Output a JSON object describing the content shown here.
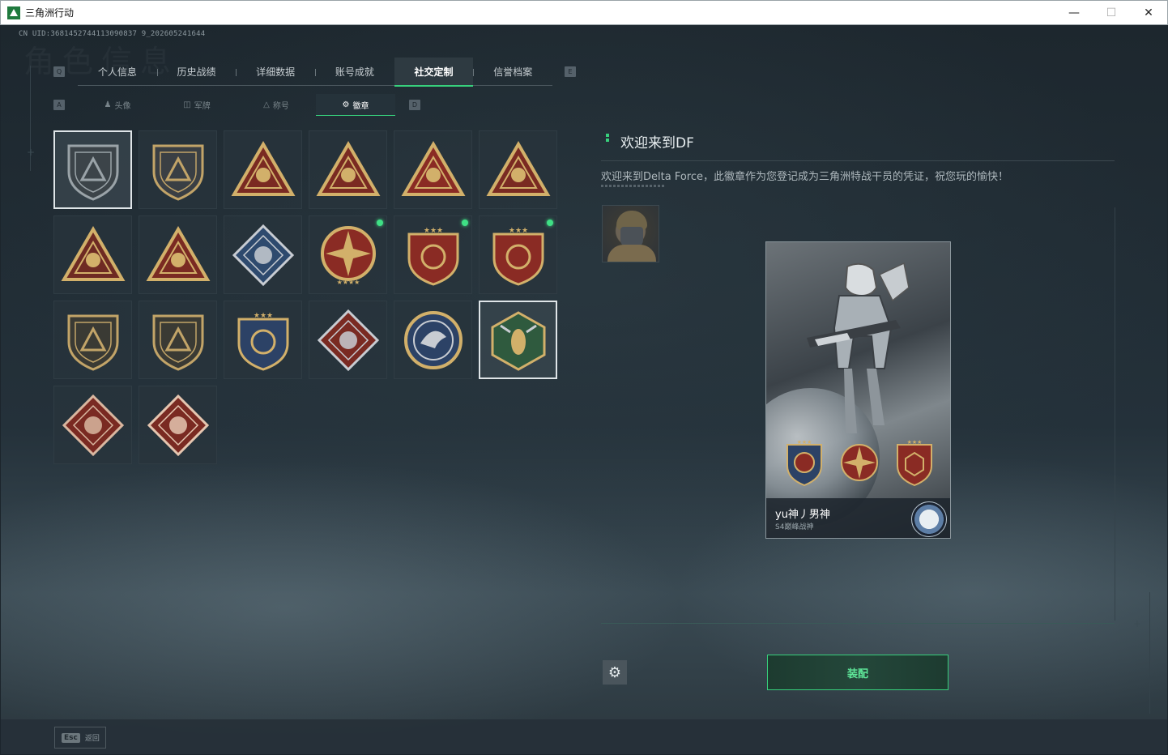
{
  "window": {
    "title": "三角洲行动",
    "minimize": "—",
    "maximize": "☐",
    "close": "✕"
  },
  "header": {
    "uid": "CN UID:3681452744113090837 9_202605241644",
    "ghost_title": "角色信息"
  },
  "top_tabs": {
    "left_key": "Q",
    "right_key": "E",
    "items": [
      {
        "label": "个人信息"
      },
      {
        "label": "历史战绩"
      },
      {
        "label": "详细数据"
      },
      {
        "label": "账号成就"
      },
      {
        "label": "社交定制",
        "active": true
      },
      {
        "label": "信誉档案"
      }
    ]
  },
  "sub_tabs": {
    "left_key": "A",
    "right_key": "D",
    "items": [
      {
        "label": "头像",
        "icon": "person-icon"
      },
      {
        "label": "军牌",
        "icon": "dogtag-icon"
      },
      {
        "label": "称号",
        "icon": "title-icon"
      },
      {
        "label": "徽章",
        "icon": "badge-icon",
        "active": true
      }
    ]
  },
  "badges": [
    {
      "name": "delta-triangle-badge",
      "shape": "shield",
      "color": "#3c4449",
      "accent": "#9aa3a8",
      "selected": true
    },
    {
      "name": "helicopter-badge",
      "shape": "shield",
      "color": "#3a3f44",
      "accent": "#c2a468"
    },
    {
      "name": "s5-season-badge",
      "shape": "triangle",
      "color": "#7a2a22",
      "accent": "#d2b06a"
    },
    {
      "name": "s7-season-badge",
      "shape": "triangle",
      "color": "#7a2a22",
      "accent": "#d2b06a"
    },
    {
      "name": "number-one-badge",
      "shape": "triangle",
      "color": "#8a2b24",
      "accent": "#d2b06a"
    },
    {
      "name": "hexagram-hands-badge",
      "shape": "triangle",
      "color": "#7a2a22",
      "accent": "#d2b06a"
    },
    {
      "name": "soldiers-badge",
      "shape": "triangle",
      "color": "#6e2a23",
      "accent": "#d2b06a"
    },
    {
      "name": "fish-badge",
      "shape": "triangle",
      "color": "#7a2a22",
      "accent": "#d2b06a"
    },
    {
      "name": "rose-badge",
      "shape": "diamond",
      "color": "#2e4a6e",
      "accent": "#c8ccd2"
    },
    {
      "name": "compass-star-badge",
      "shape": "round-shield",
      "color": "#8a2b24",
      "accent": "#d2b06a",
      "dot": true
    },
    {
      "name": "wing-emblem-badge",
      "shape": "crest",
      "color": "#8a2b24",
      "accent": "#d2b06a",
      "dot": true
    },
    {
      "name": "hex-crest-badge",
      "shape": "crest",
      "color": "#8a2b24",
      "accent": "#d2b06a",
      "dot": true
    },
    {
      "name": "rifle-shield-badge",
      "shape": "shield",
      "color": "#3a3a34",
      "accent": "#c2a468"
    },
    {
      "name": "rifle-shield-badge-2",
      "shape": "shield",
      "color": "#3a3a34",
      "accent": "#c2a468"
    },
    {
      "name": "crossed-guns-badge",
      "shape": "crest",
      "color": "#2c4266",
      "accent": "#d2b06a"
    },
    {
      "name": "wolf-badge",
      "shape": "diamond",
      "color": "#7a2a22",
      "accent": "#c8ccd2"
    },
    {
      "name": "eagle-badge",
      "shape": "circle",
      "color": "#2c4266",
      "accent": "#c8ccd2"
    },
    {
      "name": "wasp-badge",
      "shape": "hexagon",
      "color": "#2f5a3e",
      "accent": "#d2b06a",
      "selected": true
    },
    {
      "name": "dragon-badge",
      "shape": "diamond",
      "color": "#7a2a22",
      "accent": "#d9b7a0"
    },
    {
      "name": "runner-badge",
      "shape": "diamond",
      "color": "#7a2a22",
      "accent": "#e5c6b0"
    }
  ],
  "detail": {
    "title": "欢迎来到DF",
    "description": "欢迎来到Delta Force，此徽章作为您登记成为三角洲特战干员的凭证，祝您玩的愉快！"
  },
  "card": {
    "player_name": "yu神丿男神",
    "player_title": "S4巅峰战神"
  },
  "actions": {
    "equip": "装配",
    "settings_icon": "gear-icon"
  },
  "footer": {
    "esc_key": "Esc",
    "esc_label": "返回"
  },
  "colors": {
    "accent": "#37d07c",
    "background": "#1c252c"
  }
}
